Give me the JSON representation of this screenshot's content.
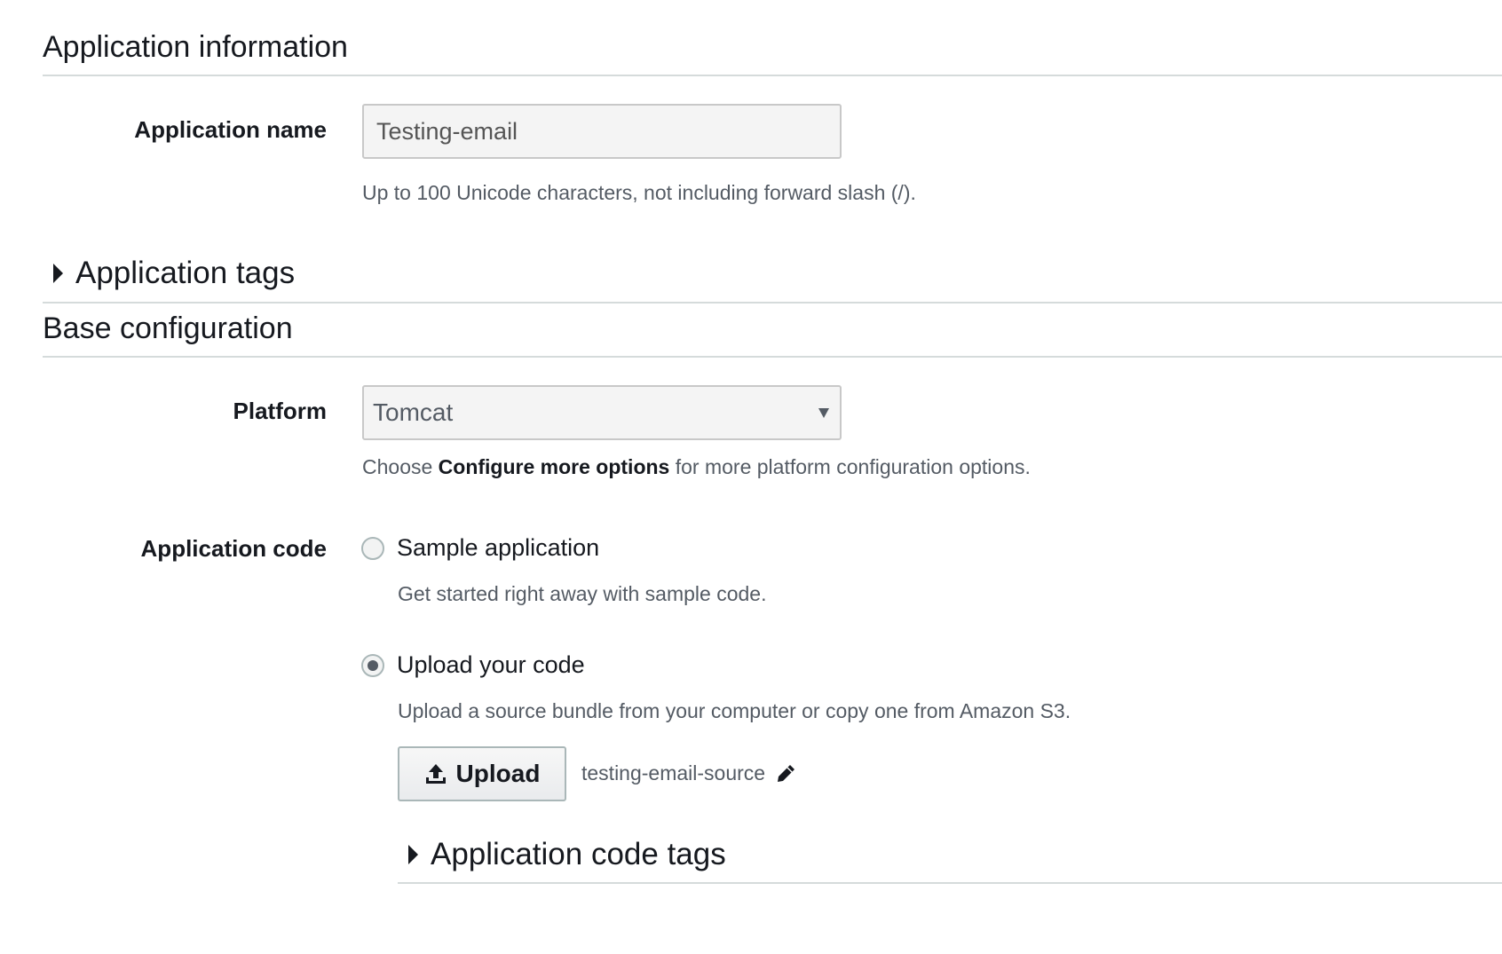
{
  "application_information": {
    "header": "Application information",
    "name_label": "Application name",
    "name_value": "Testing-email",
    "name_help": "Up to 100 Unicode characters, not including forward slash (/).",
    "tags_label": "Application tags"
  },
  "base_configuration": {
    "header": "Base configuration",
    "platform_label": "Platform",
    "platform_value": "Tomcat",
    "platform_help_prefix": "Choose ",
    "platform_help_bold": "Configure more options",
    "platform_help_suffix": " for more platform configuration options.",
    "code_label": "Application code",
    "options": [
      {
        "label": "Sample application",
        "help": "Get started right away with sample code.",
        "selected": false
      },
      {
        "label": "Upload your code",
        "help": "Upload a source bundle from your computer or copy one from Amazon S3.",
        "selected": true
      }
    ],
    "upload_button": "Upload",
    "source_name": "testing-email-source",
    "code_tags_label": "Application code tags"
  },
  "colors": {
    "text": "#16191f",
    "muted": "#545b64",
    "border": "#d5dbdb"
  },
  "icons": [
    "caret-right-icon",
    "dropdown-arrow-icon",
    "upload-icon",
    "pencil-icon"
  ]
}
